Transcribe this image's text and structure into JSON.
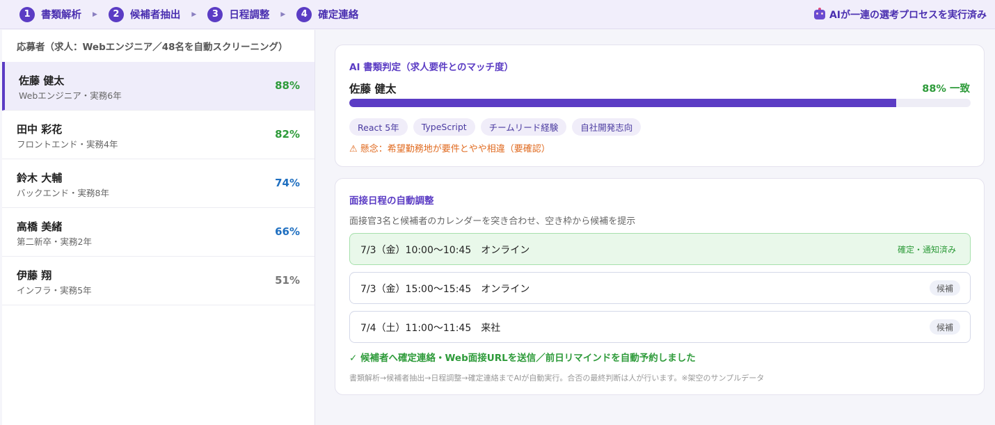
{
  "steps": [
    {
      "num": "1",
      "label": "書類解析"
    },
    {
      "num": "2",
      "label": "候補者抽出"
    },
    {
      "num": "3",
      "label": "日程調整"
    },
    {
      "num": "4",
      "label": "確定連絡"
    }
  ],
  "status": {
    "icon": "robot-icon",
    "text": "AIが一連の選考プロセスを実行済み"
  },
  "sidebar": {
    "header": "応募者（求人：Webエンジニア／48名を自動スクリーニング）",
    "candidates": [
      {
        "name": "佐藤 健太",
        "sub": "Webエンジニア・実務6年",
        "score": "88%",
        "score_color": "#2e9b3a"
      },
      {
        "name": "田中 彩花",
        "sub": "フロントエンド・実務4年",
        "score": "82%",
        "score_color": "#2e9b3a"
      },
      {
        "name": "鈴木 大輔",
        "sub": "バックエンド・実務8年",
        "score": "74%",
        "score_color": "#1f6fc0"
      },
      {
        "name": "高橋 美緒",
        "sub": "第二新卒・実務2年",
        "score": "66%",
        "score_color": "#1f6fc0"
      },
      {
        "name": "伊藤 翔",
        "sub": "インフラ・実務5年",
        "score": "51%",
        "score_color": "#777777"
      }
    ]
  },
  "match": {
    "title": "AI 書類判定（求人要件とのマッチ度）",
    "name": "佐藤 健太",
    "score_label": "88% 一致",
    "score_value": 88,
    "tags": [
      "React 5年",
      "TypeScript",
      "チームリード経験",
      "自社開発志向"
    ],
    "concern": "⚠ 懸念：希望勤務地が要件とやや相違（要確認）"
  },
  "schedule": {
    "title": "面接日程の自動調整",
    "description": "面接官3名と候補者のカレンダーを突き合わせ、空き枠から候補を提示",
    "slots": [
      {
        "text": "7/3（金）10:00〜10:45　オンライン",
        "badge": "確定・通知済み"
      },
      {
        "text": "7/3（金）15:00〜15:45　オンライン",
        "badge": "候補"
      },
      {
        "text": "7/4（土）11:00〜11:45　来社",
        "badge": "候補"
      }
    ],
    "done": "✓ 候補者へ確定連絡・Web面接URLを送信／前日リマインドを自動予約しました",
    "footnote": "書類解析→候補者抽出→日程調整→確定連絡までAIが自動実行。合否の最終判断は人が行います。※架空のサンプルデータ"
  },
  "colors": {
    "accent": "#5b3cc4",
    "success": "#2e9b3a",
    "warning": "#e06a1f"
  }
}
